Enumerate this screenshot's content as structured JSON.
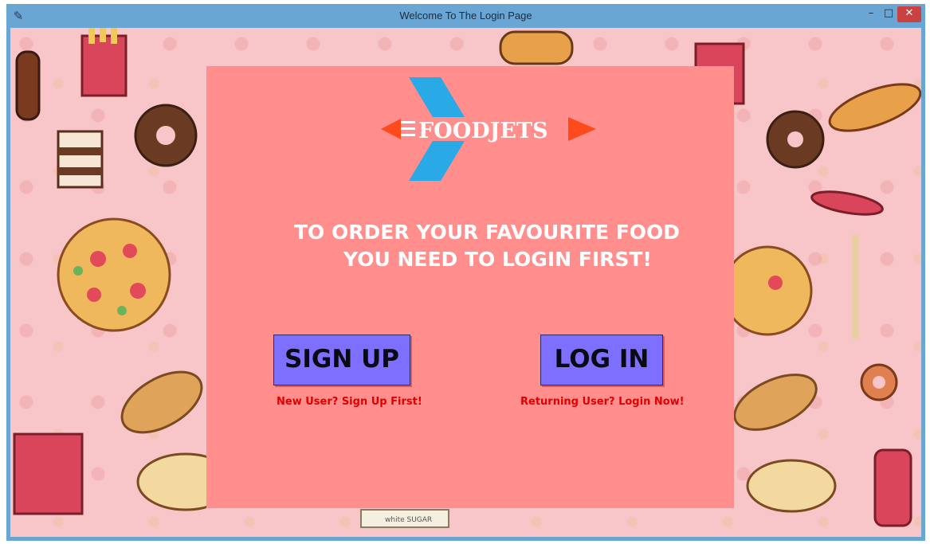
{
  "window": {
    "title": "Welcome To The Login Page",
    "icon": "feather-icon",
    "controls": {
      "minimize": "–",
      "maximize": "□",
      "close": "✕"
    }
  },
  "logo": {
    "text": "FOODJETS",
    "icon": "jet-icon",
    "colors": {
      "wing": "#29a9e6",
      "accent": "#ff4a1c",
      "text": "#ffffff"
    }
  },
  "headline": {
    "line1": "TO ORDER YOUR FAVOURITE FOOD",
    "line2": "YOU NEED TO LOGIN FIRST!"
  },
  "signup": {
    "label": "SIGN UP",
    "hint": "New User? Sign Up First!"
  },
  "login": {
    "label": "LOG IN",
    "hint": "Returning User? Login Now!"
  },
  "background": {
    "wrapper_text": "white SUGAR"
  },
  "colors": {
    "panel": "#ff8e8c",
    "button": "#7f6fff",
    "hint": "#e00000",
    "page_background": "#f8c5c8",
    "titlebar": "#6aa6d4"
  }
}
